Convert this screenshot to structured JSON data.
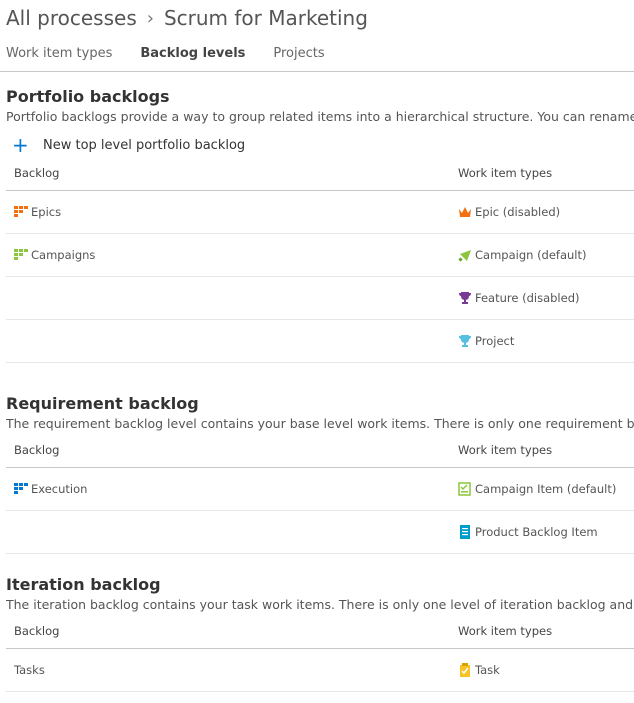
{
  "breadcrumb": {
    "root": "All processes",
    "current": "Scrum for Marketing"
  },
  "tabs": [
    {
      "label": "Work item types",
      "active": false
    },
    {
      "label": "Backlog levels",
      "active": true
    },
    {
      "label": "Projects",
      "active": false
    }
  ],
  "portfolio": {
    "title": "Portfolio backlogs",
    "description": "Portfolio backlogs provide a way to group related items into a hierarchical structure. You can rename a",
    "new_button": "New top level portfolio backlog",
    "col_backlog": "Backlog",
    "col_types": "Work item types",
    "rows": [
      {
        "backlog": "Epics",
        "backlog_icon": "backlog-orange-icon",
        "type": "Epic (disabled)",
        "type_icon": "crown-icon"
      },
      {
        "backlog": "Campaigns",
        "backlog_icon": "backlog-green-icon",
        "type": "Campaign (default)",
        "type_icon": "megaphone-icon"
      },
      {
        "backlog": "",
        "type": "Feature (disabled)",
        "type_icon": "trophy-purple-icon"
      },
      {
        "backlog": "",
        "type": "Project",
        "type_icon": "trophy-blue-icon"
      }
    ]
  },
  "requirement": {
    "title": "Requirement backlog",
    "description": "The requirement backlog level contains your base level work items. There is only one requirement bac",
    "col_backlog": "Backlog",
    "col_types": "Work item types",
    "rows": [
      {
        "backlog": "Execution",
        "backlog_icon": "backlog-blue-icon",
        "type": "Campaign Item (default)",
        "type_icon": "checklist-icon"
      },
      {
        "backlog": "",
        "type": "Product Backlog Item",
        "type_icon": "document-icon"
      }
    ]
  },
  "iteration": {
    "title": "Iteration backlog",
    "description": "The iteration backlog contains your task work items. There is only one level of iteration backlog and it",
    "col_backlog": "Backlog",
    "col_types": "Work item types",
    "rows": [
      {
        "backlog": "Tasks",
        "type": "Task",
        "type_icon": "clipboard-icon"
      }
    ]
  },
  "colors": {
    "accent": "#0078d4",
    "orange": "#f2700f",
    "green": "#8cc63f",
    "blue": "#0078d4",
    "purple": "#773b93",
    "light_blue": "#56c0e0",
    "yellow": "#f7c325",
    "teal": "#009ccc"
  }
}
